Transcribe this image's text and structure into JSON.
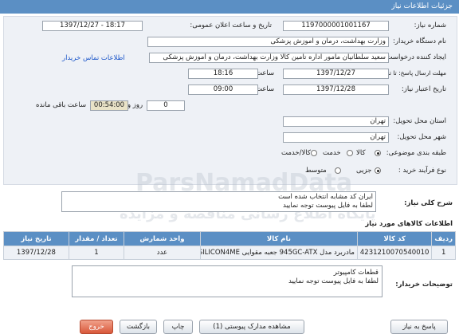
{
  "window": {
    "title": "جزئیات اطلاعات نیاز"
  },
  "form": {
    "need_number_label": "شماره نیاز:",
    "need_number": "1197000001001167",
    "announce_label": "تاریخ و ساعت اعلان عمومی:",
    "announce_value": "1397/12/27 - 18:17",
    "buyer_label": "نام دستگاه خریدار:",
    "buyer_value": "وزارت بهداشت، درمان و آموزش پزشکی",
    "creator_label": "ایجاد کننده درخواست:",
    "creator_value": "سعید سلطانیان مامور اداره تامین کالا وزارت بهداشت، درمان و آموزش پزشکی",
    "contact_link": "اطلاعات تماس خریدار",
    "send_deadline_label": "مهلت ارسال پاسخ: تا تاریخ:",
    "send_date": "1397/12/27",
    "hour_label": "ساعت",
    "send_time": "18:16",
    "validity_label": "تاریخ اعتبار نیاز:",
    "validity_date": "1397/12/28",
    "validity_hour_label": "ساعت",
    "validity_time": "09:00",
    "days_label": "روز و",
    "days_value": "0",
    "remaining_time": "00:54:00",
    "remaining_label": "ساعت باقی مانده",
    "province_label": "استان محل تحویل:",
    "province_value": "تهران",
    "city_label": "شهر محل تحویل:",
    "city_value": "تهران",
    "category_label": "طبقه بندی موضوعی:",
    "category_options": [
      "کالا",
      "خدمت",
      "کالا/خدمت"
    ],
    "category_selected": "کالا",
    "process_label": "نوع فرآیند خرید :",
    "process_options": [
      "جزیی",
      "متوسط"
    ],
    "process_selected": "جزیی"
  },
  "summary": {
    "label": "شرح کلی نیاز:",
    "lines": [
      "ایران کد مشابه انتخاب شده است",
      "لطفا به فایل پیوست توجه نمایید"
    ]
  },
  "goods": {
    "title": "اطلاعات کالاهای مورد نیاز",
    "columns": [
      "ردیف",
      "کد کالا",
      "نام کالا",
      "واحد شمارش",
      "تعداد / مقدار",
      "تاریخ نیاز"
    ],
    "rows": [
      [
        "1",
        "4231210070540010",
        "مادربرد مدل 945GC-ATX جعبه مقوایی SILICON4ME",
        "عدد",
        "1",
        "1397/12/28"
      ]
    ]
  },
  "buyer_notes": {
    "label": "توضیحات خریدار:",
    "lines": [
      "قطعات کامپیوتر",
      "لطفا به فایل پیوست توجه نمایید"
    ]
  },
  "buttons": {
    "exit": "خروج",
    "back": "بازگشت",
    "print": "چاپ",
    "view_attachments": "مشاهده مدارک پیوستی (1)",
    "reply": "پاسخ به نیاز"
  },
  "watermark": {
    "line1": "ParsNamadData",
    "line2": "پایگاه اطلاع رسانی مناقصه و مزایده"
  }
}
